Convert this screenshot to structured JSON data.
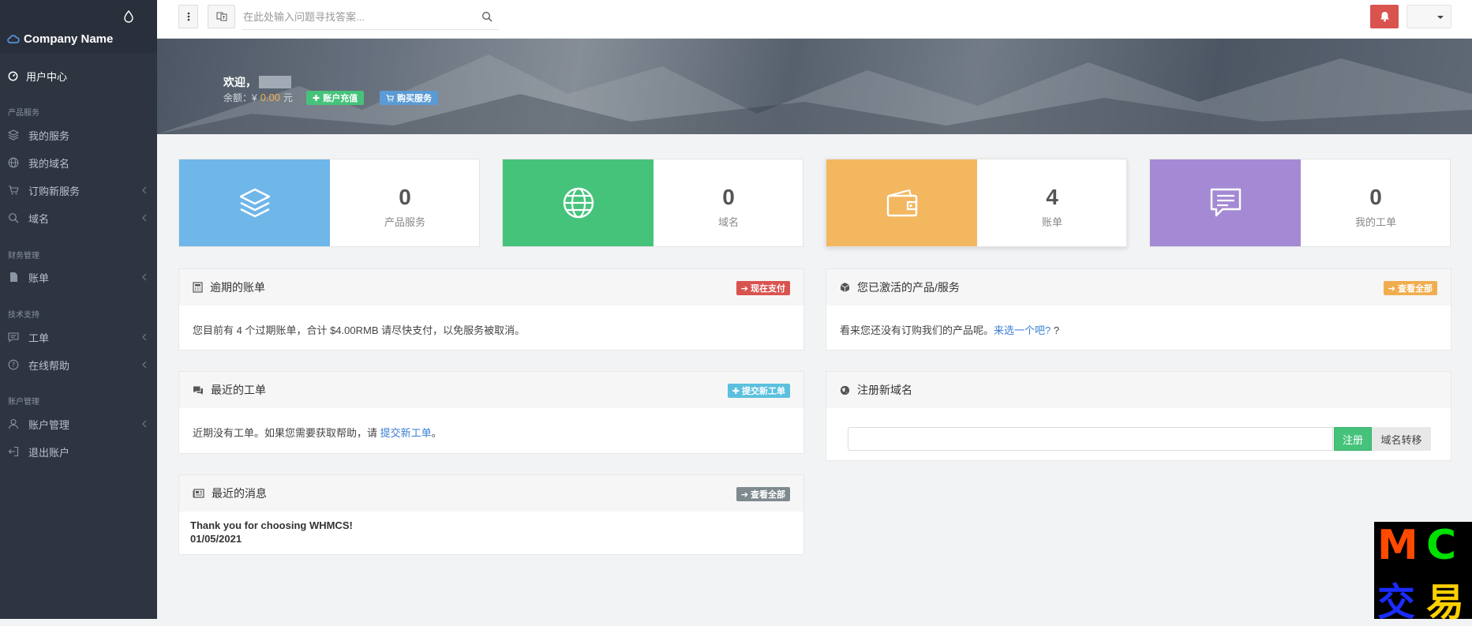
{
  "sidebar": {
    "brand": "Company Name",
    "user_center": "用户中心",
    "sections": {
      "products": "产品服务",
      "finance": "财务管理",
      "support": "技术支持",
      "account": "账户管理"
    },
    "items": {
      "my_services": "我的服务",
      "my_domains": "我的域名",
      "order_new": "订购新服务",
      "domains": "域名",
      "invoices": "账单",
      "tickets": "工单",
      "online_help": "在线帮助",
      "account_manage": "账户管理",
      "logout": "退出账户"
    }
  },
  "topbar": {
    "search_placeholder": "在此处输入问题寻找答案..."
  },
  "banner": {
    "welcome": "欢迎，",
    "balance_label": "余额：¥",
    "balance_amount": "0.00",
    "balance_unit": "元",
    "recharge_label": "账户充值",
    "buy_label": "购买服务"
  },
  "stats": [
    {
      "value": "0",
      "label": "产品服务",
      "color": "#6fb6e9",
      "icon": "layers-icon"
    },
    {
      "value": "0",
      "label": "域名",
      "color": "#46c37b",
      "icon": "globe-icon"
    },
    {
      "value": "4",
      "label": "账单",
      "color": "#f3b760",
      "icon": "wallet-icon"
    },
    {
      "value": "0",
      "label": "我的工单",
      "color": "#a48ad4",
      "icon": "message-icon"
    }
  ],
  "panels": {
    "overdue": {
      "title": "逾期的账单",
      "button": "现在支付",
      "text": "您目前有 4 个过期账单，合计 $4.00RMB 请尽快支付，以免服务被取消。"
    },
    "active": {
      "title": "您已激活的产品/服务",
      "button": "查看全部",
      "text_before": "看来您还没有订购我们的产品呢。",
      "link": "来选一个吧?",
      "text_after": "?"
    },
    "tickets": {
      "title": "最近的工单",
      "button": "提交新工单",
      "text_before": "近期没有工单。如果您需要获取帮助，请",
      "link": "提交新工单",
      "text_after": "。"
    },
    "register": {
      "title": "注册新域名",
      "register_button": "注册",
      "transfer_button": "域名转移"
    },
    "news": {
      "title": "最近的消息",
      "button": "查看全部",
      "item_title": "Thank you for choosing WHMCS!",
      "item_date": "01/05/2021"
    }
  },
  "watermark": {
    "chars": [
      "M",
      "C",
      "交",
      "易"
    ]
  },
  "colors": {
    "sidebar": "#2e3541",
    "danger": "#d9534f",
    "success": "#46c37b",
    "info": "#5bc0de",
    "warning": "#f0ad4e",
    "primary": "#5b9bd5",
    "muted": "#7f8a8f"
  }
}
